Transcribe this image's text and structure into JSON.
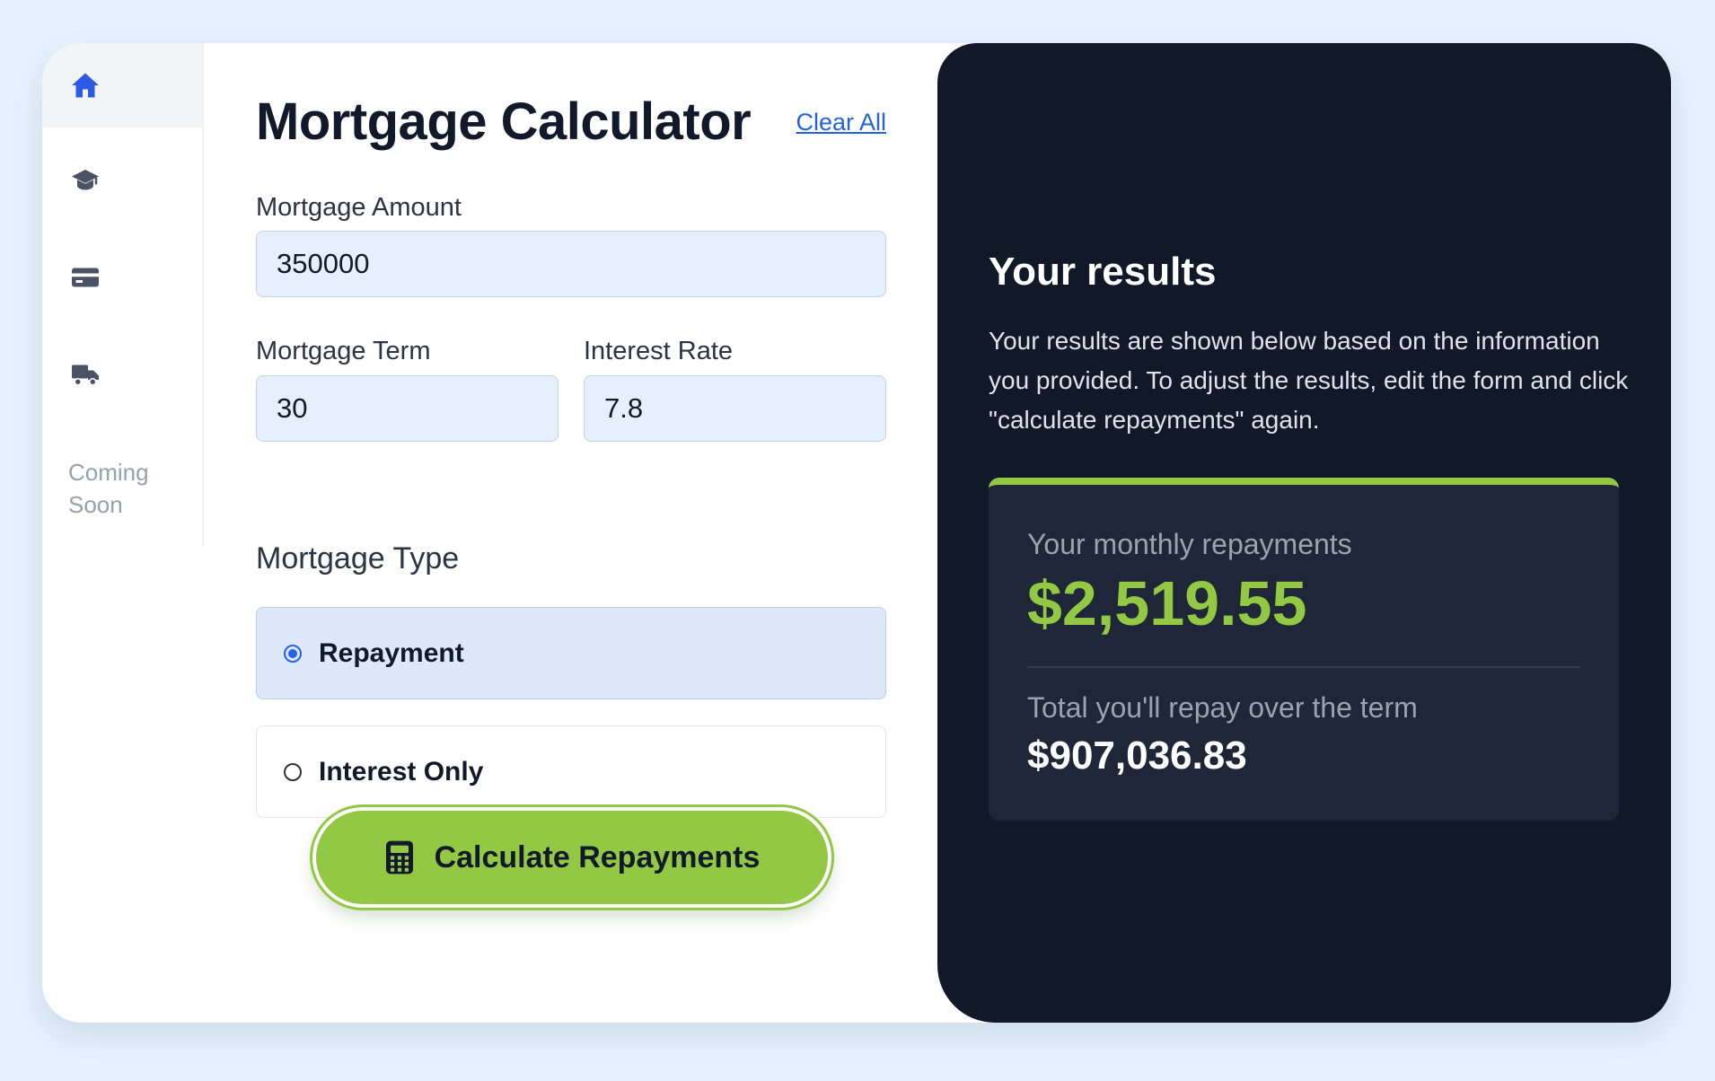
{
  "sidebar": {
    "items": [
      {
        "icon": "home-icon",
        "active": true
      },
      {
        "icon": "graduation-cap-icon",
        "active": false
      },
      {
        "icon": "credit-card-icon",
        "active": false
      },
      {
        "icon": "truck-icon",
        "active": false
      }
    ],
    "coming_soon": "Coming Soon"
  },
  "form": {
    "title": "Mortgage Calculator",
    "clear_all": "Clear All",
    "amount": {
      "label": "Mortgage Amount",
      "value": "350000"
    },
    "term": {
      "label": "Mortgage Term",
      "value": "30"
    },
    "rate": {
      "label": "Interest Rate",
      "value": "7.8"
    },
    "type_label": "Mortgage Type",
    "options": [
      {
        "label": "Repayment",
        "selected": true
      },
      {
        "label": "Interest Only",
        "selected": false
      }
    ],
    "calculate_label": "Calculate Repayments"
  },
  "results": {
    "title": "Your results",
    "description": "Your results are shown below based on the information you provided. To adjust the results, edit the form and click \"calculate repayments\" again.",
    "monthly_label": "Your monthly repayments",
    "monthly_value": "$2,519.55",
    "total_label": "Total you'll repay over the term",
    "total_value": "$907,036.83"
  },
  "colors": {
    "accent_lime": "#92c843",
    "primary_blue": "#2563eb",
    "dark_panel": "#111828",
    "page_bg": "#e4f0fb"
  }
}
